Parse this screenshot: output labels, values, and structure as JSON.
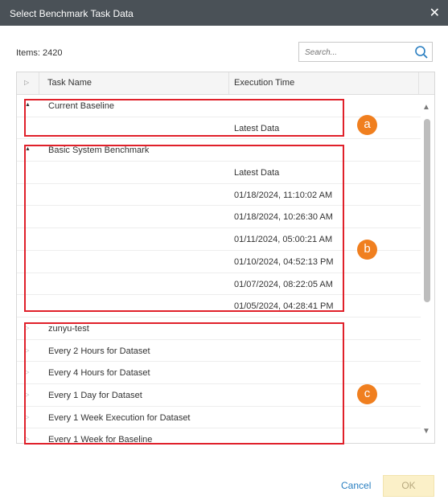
{
  "window": {
    "title": "Select Benchmark Task Data",
    "close_glyph": "✕"
  },
  "items_label": "Items: 2420",
  "search": {
    "placeholder": "Search...",
    "icon": "search-icon"
  },
  "table": {
    "columns": [
      "Task Name",
      "Execution Time"
    ],
    "rows": [
      {
        "toggle": "▲",
        "name": "Current Baseline",
        "time": ""
      },
      {
        "toggle": "",
        "name": "",
        "time": "Latest Data"
      },
      {
        "toggle": "▲",
        "name": "Basic System Benchmark",
        "time": ""
      },
      {
        "toggle": "",
        "name": "",
        "time": "Latest Data"
      },
      {
        "toggle": "",
        "name": "",
        "time": "01/18/2024, 11:10:02 AM"
      },
      {
        "toggle": "",
        "name": "",
        "time": "01/18/2024, 10:26:30 AM"
      },
      {
        "toggle": "",
        "name": "",
        "time": "01/11/2024, 05:00:21 AM"
      },
      {
        "toggle": "",
        "name": "",
        "time": "01/10/2024, 04:52:13 PM"
      },
      {
        "toggle": "",
        "name": "",
        "time": "01/07/2024, 08:22:05 AM"
      },
      {
        "toggle": "",
        "name": "",
        "time": "01/05/2024, 04:28:41 PM"
      },
      {
        "toggle": "▷",
        "name": "zunyu-test",
        "time": ""
      },
      {
        "toggle": "▷",
        "name": "Every 2 Hours for Dataset",
        "time": ""
      },
      {
        "toggle": "▷",
        "name": "Every 4 Hours for Dataset",
        "time": ""
      },
      {
        "toggle": "▷",
        "name": "Every 1 Day for Dataset",
        "time": ""
      },
      {
        "toggle": "▷",
        "name": "Every 1 Week Execution for Dataset",
        "time": ""
      },
      {
        "toggle": "▷",
        "name": "Every 1 Week for Baseline",
        "time": ""
      }
    ]
  },
  "annotations": [
    {
      "label": "a",
      "color": "#f07f1f"
    },
    {
      "label": "b",
      "color": "#f07f1f"
    },
    {
      "label": "c",
      "color": "#f07f1f"
    }
  ],
  "buttons": {
    "cancel": "Cancel",
    "ok": "OK"
  }
}
